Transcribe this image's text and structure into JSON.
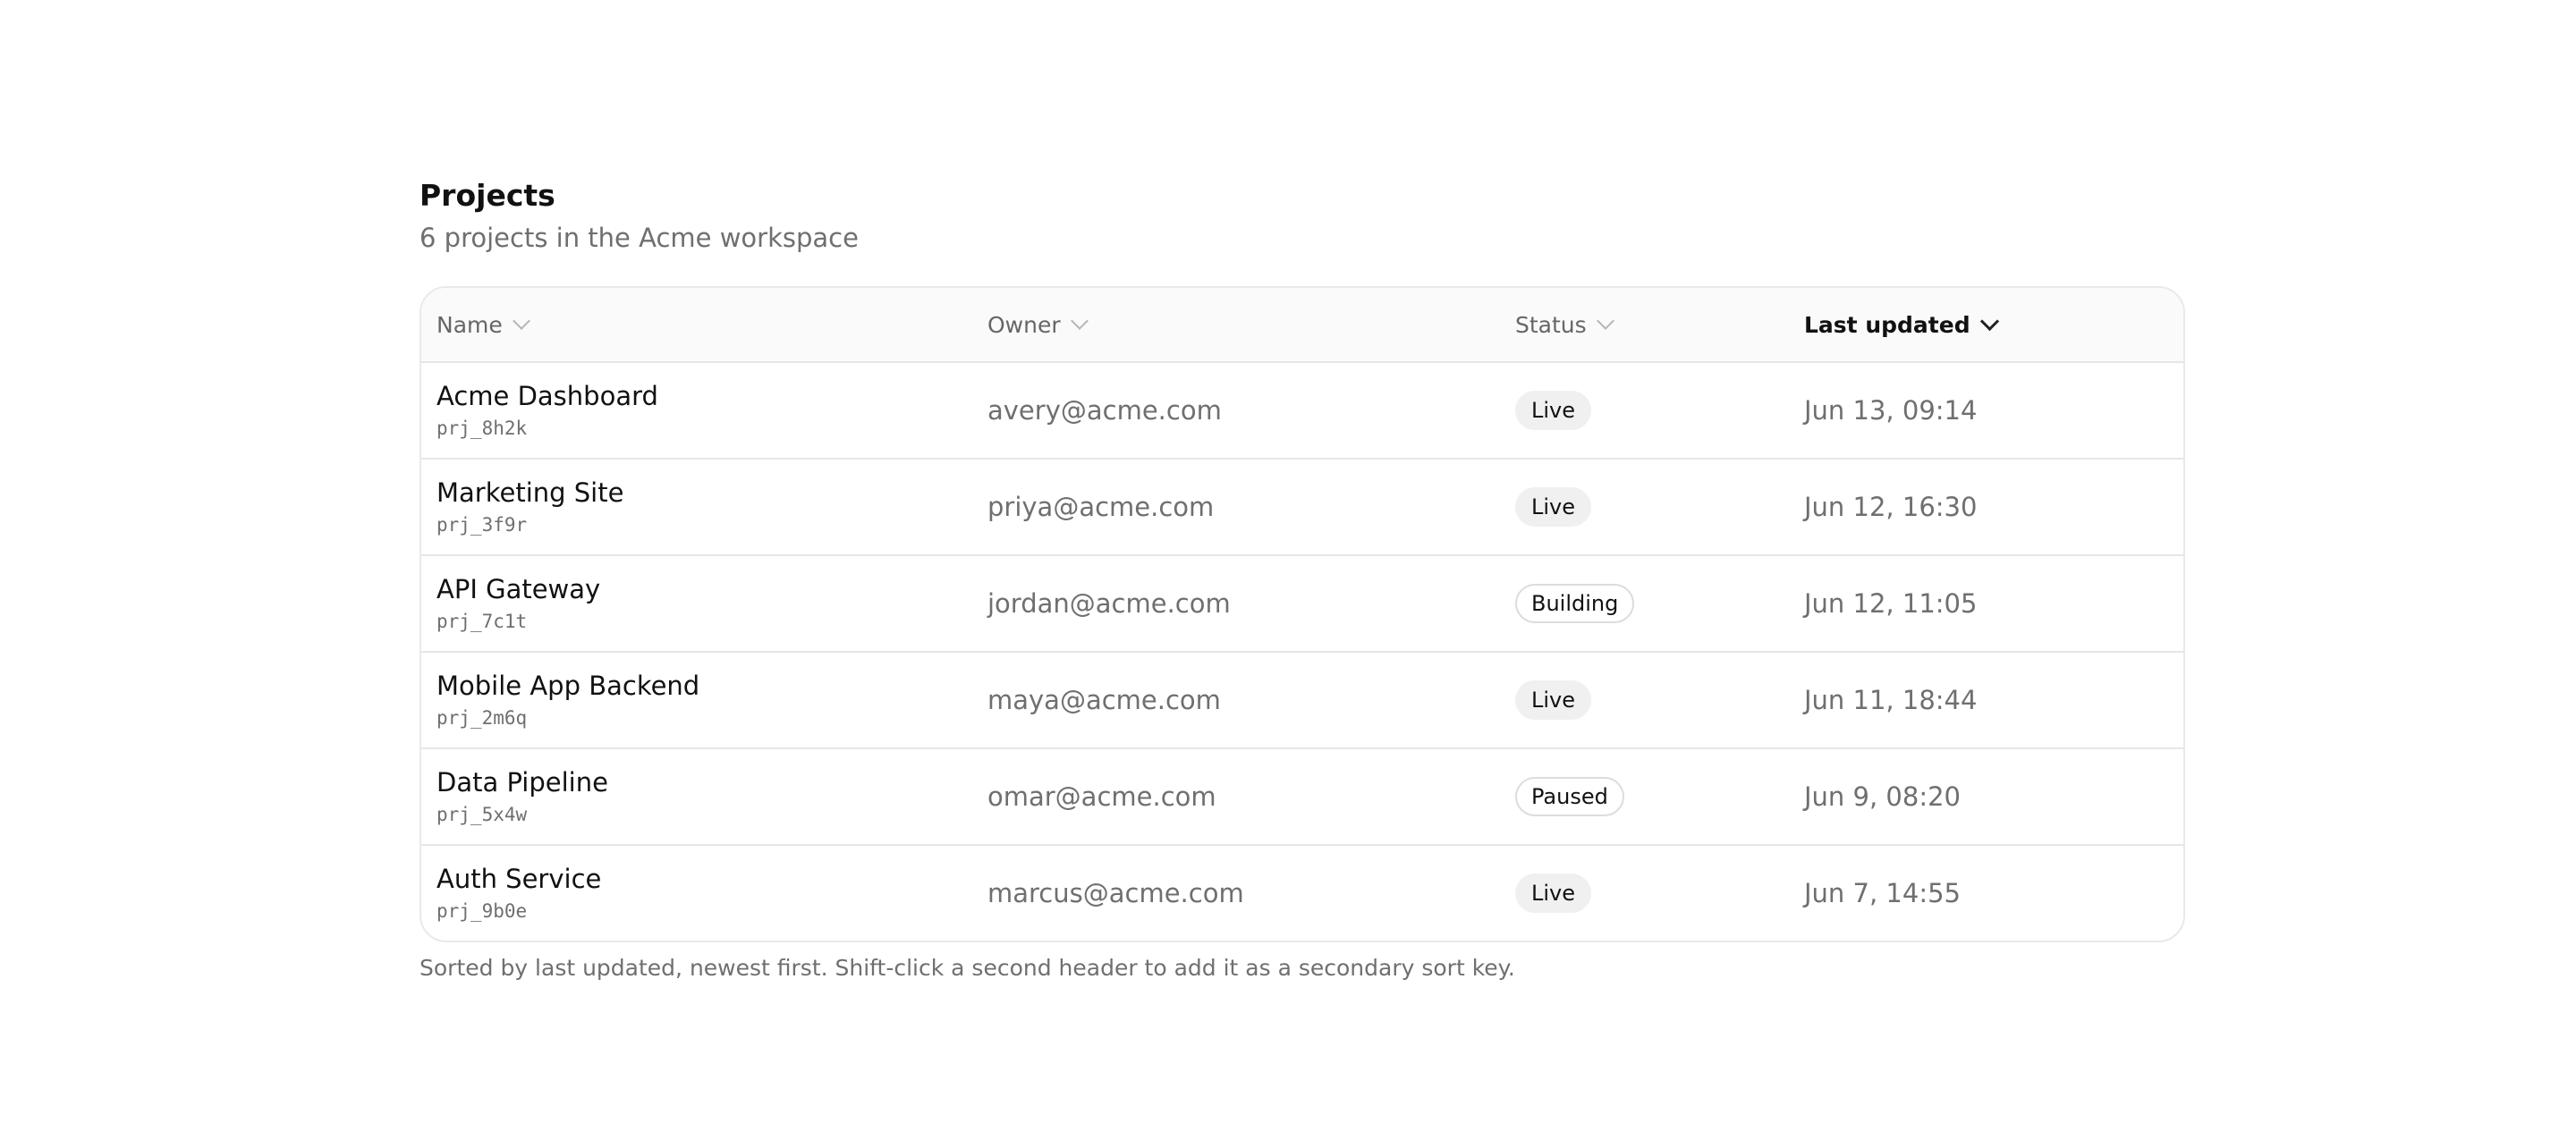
{
  "header": {
    "title": "Projects",
    "subtitle": "6 projects in the Acme workspace"
  },
  "table": {
    "columns": [
      {
        "label": "Name",
        "sorted": false
      },
      {
        "label": "Owner",
        "sorted": false
      },
      {
        "label": "Status",
        "sorted": false
      },
      {
        "label": "Last updated",
        "sorted": true,
        "direction": "descending"
      }
    ],
    "rows": [
      {
        "name": "Acme Dashboard",
        "id": "prj_8h2k",
        "owner": "avery@acme.com",
        "status": "Live",
        "updated": "Jun 13, 09:14"
      },
      {
        "name": "Marketing Site",
        "id": "prj_3f9r",
        "owner": "priya@acme.com",
        "status": "Live",
        "updated": "Jun 12, 16:30"
      },
      {
        "name": "API Gateway",
        "id": "prj_7c1t",
        "owner": "jordan@acme.com",
        "status": "Building",
        "updated": "Jun 12, 11:05"
      },
      {
        "name": "Mobile App Backend",
        "id": "prj_2m6q",
        "owner": "maya@acme.com",
        "status": "Live",
        "updated": "Jun 11, 18:44"
      },
      {
        "name": "Data Pipeline",
        "id": "prj_5x4w",
        "owner": "omar@acme.com",
        "status": "Paused",
        "updated": "Jun 9, 08:20"
      },
      {
        "name": "Auth Service",
        "id": "prj_9b0e",
        "owner": "marcus@acme.com",
        "status": "Live",
        "updated": "Jun 7, 14:55"
      }
    ]
  },
  "footer": {
    "note": "Sorted by last updated, newest first. Shift-click a second header to add it as a secondary sort key."
  }
}
